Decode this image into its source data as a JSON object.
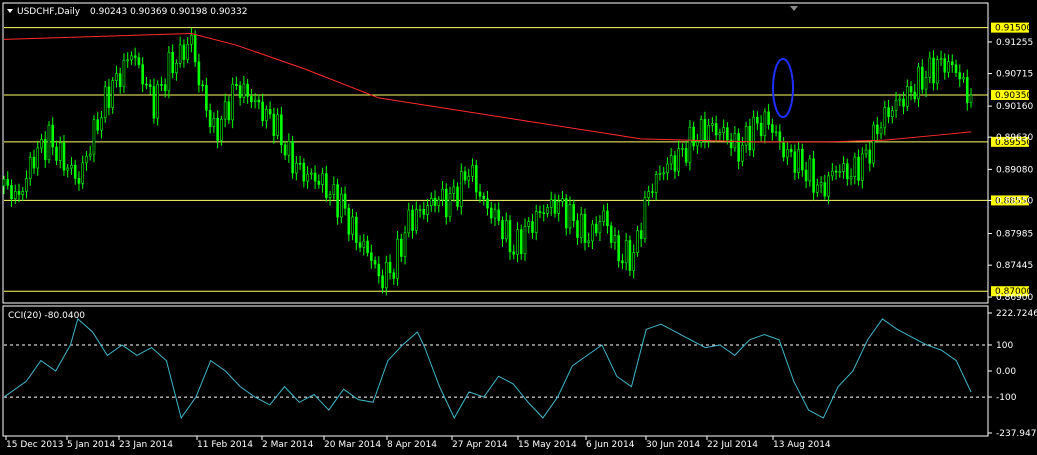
{
  "window": {
    "symbol_title": "USDCHF,Daily",
    "ohlc": "0.90243 0.90369 0.90198 0.90332",
    "menu_arrow": "triangle-down-icon"
  },
  "colors": {
    "background": "#000000",
    "candle_up": "#00ff00",
    "candle_down": "#00ff00",
    "moving_average": "#ff2a2a",
    "horizontal_level": "#ffff66",
    "level_box": "#ffff00",
    "cci_line": "#3fb6c8",
    "annotation_ellipse": "#1f2fff",
    "grid_frame": "#ffffff"
  },
  "chart_data": [
    {
      "type": "candlestick",
      "title": "USDCHF,Daily",
      "ylim": [
        0.8685,
        0.9163
      ],
      "y_ticks": [
        "0.91255",
        "0.90715",
        "0.90160",
        "0.89630",
        "0.89080",
        "0.88550",
        "0.87985",
        "0.87445",
        "0.86900"
      ],
      "x_tick_labels": [
        "15 Dec 2013",
        "5 Jan 2014",
        "23 Jan 2014",
        "11 Feb 2014",
        "2 Mar 2014",
        "20 Mar 2014",
        "8 Apr 2014",
        "27 Apr 2014",
        "15 May 2014",
        "6 Jun 2014",
        "30 Jun 2014",
        "22 Jul 2014",
        "13 Aug 2014"
      ],
      "horizontal_levels": [
        "0.91500",
        "0.90350",
        "0.89550",
        "0.88550",
        "0.87000"
      ],
      "close_path": [
        [
          0,
          0.888
        ],
        [
          4,
          0.886
        ],
        [
          8,
          0.893
        ],
        [
          12,
          0.896
        ],
        [
          16,
          0.892
        ],
        [
          20,
          0.889
        ],
        [
          24,
          0.897
        ],
        [
          28,
          0.904
        ],
        [
          32,
          0.908
        ],
        [
          34,
          0.911
        ],
        [
          38,
          0.905
        ],
        [
          40,
          0.902
        ],
        [
          44,
          0.908
        ],
        [
          48,
          0.911
        ],
        [
          50,
          0.913
        ],
        [
          52,
          0.906
        ],
        [
          56,
          0.897
        ],
        [
          58,
          0.899
        ],
        [
          62,
          0.905
        ],
        [
          66,
          0.903
        ],
        [
          70,
          0.9
        ],
        [
          72,
          0.899
        ],
        [
          76,
          0.893
        ],
        [
          80,
          0.89
        ],
        [
          84,
          0.889
        ],
        [
          88,
          0.886
        ],
        [
          90,
          0.885
        ],
        [
          94,
          0.879
        ],
        [
          98,
          0.876
        ],
        [
          100,
          0.872
        ],
        [
          104,
          0.874
        ],
        [
          108,
          0.882
        ],
        [
          112,
          0.884
        ],
        [
          116,
          0.886
        ],
        [
          118,
          0.885
        ],
        [
          122,
          0.888
        ],
        [
          124,
          0.891
        ],
        [
          128,
          0.885
        ],
        [
          132,
          0.882
        ],
        [
          136,
          0.877
        ],
        [
          140,
          0.881
        ],
        [
          144,
          0.884
        ],
        [
          148,
          0.885
        ],
        [
          152,
          0.882
        ],
        [
          156,
          0.879
        ],
        [
          160,
          0.883
        ],
        [
          164,
          0.876
        ],
        [
          168,
          0.876
        ],
        [
          172,
          0.887
        ],
        [
          176,
          0.891
        ],
        [
          180,
          0.893
        ],
        [
          184,
          0.896
        ],
        [
          188,
          0.898
        ],
        [
          192,
          0.897
        ],
        [
          196,
          0.894
        ],
        [
          200,
          0.898
        ],
        [
          204,
          0.899
        ],
        [
          208,
          0.894
        ],
        [
          212,
          0.892
        ],
        [
          216,
          0.889
        ],
        [
          218,
          0.887
        ],
        [
          222,
          0.891
        ],
        [
          226,
          0.89
        ],
        [
          230,
          0.893
        ],
        [
          234,
          0.899
        ],
        [
          238,
          0.902
        ],
        [
          242,
          0.904
        ],
        [
          246,
          0.907
        ],
        [
          250,
          0.909
        ],
        [
          254,
          0.908
        ],
        [
          256,
          0.905
        ],
        [
          258,
          0.903
        ]
      ],
      "moving_average": [
        [
          0,
          0.913
        ],
        [
          50,
          0.914
        ],
        [
          62,
          0.912
        ],
        [
          80,
          0.908
        ],
        [
          100,
          0.903
        ],
        [
          120,
          0.901
        ],
        [
          140,
          0.899
        ],
        [
          160,
          0.897
        ],
        [
          170,
          0.896
        ],
        [
          200,
          0.8955
        ],
        [
          220,
          0.8955
        ],
        [
          235,
          0.8958
        ],
        [
          250,
          0.8967
        ],
        [
          258,
          0.8972
        ]
      ]
    },
    {
      "type": "line",
      "title": "CCI(20) -80.0400",
      "ylim": [
        -237.9474,
        222.7246
      ],
      "y_ticks": [
        "222.7246",
        "100",
        "0.00",
        "-100",
        "-237.9474"
      ],
      "dashed_levels": [
        100,
        -100
      ],
      "values": [
        [
          0,
          -100
        ],
        [
          6,
          -40
        ],
        [
          10,
          40
        ],
        [
          14,
          0
        ],
        [
          18,
          100
        ],
        [
          20,
          200
        ],
        [
          24,
          150
        ],
        [
          28,
          60
        ],
        [
          32,
          100
        ],
        [
          36,
          60
        ],
        [
          40,
          90
        ],
        [
          44,
          40
        ],
        [
          48,
          -180
        ],
        [
          52,
          -100
        ],
        [
          56,
          40
        ],
        [
          60,
          0
        ],
        [
          64,
          -60
        ],
        [
          68,
          -100
        ],
        [
          72,
          -130
        ],
        [
          76,
          -60
        ],
        [
          80,
          -120
        ],
        [
          84,
          -90
        ],
        [
          88,
          -150
        ],
        [
          92,
          -70
        ],
        [
          96,
          -110
        ],
        [
          100,
          -120
        ],
        [
          104,
          40
        ],
        [
          108,
          100
        ],
        [
          112,
          150
        ],
        [
          114,
          90
        ],
        [
          118,
          -60
        ],
        [
          122,
          -180
        ],
        [
          126,
          -80
        ],
        [
          130,
          -100
        ],
        [
          134,
          -20
        ],
        [
          138,
          -50
        ],
        [
          142,
          -120
        ],
        [
          146,
          -180
        ],
        [
          150,
          -100
        ],
        [
          154,
          20
        ],
        [
          158,
          60
        ],
        [
          162,
          100
        ],
        [
          166,
          -20
        ],
        [
          170,
          -60
        ],
        [
          174,
          160
        ],
        [
          178,
          180
        ],
        [
          182,
          150
        ],
        [
          186,
          120
        ],
        [
          190,
          90
        ],
        [
          194,
          100
        ],
        [
          198,
          60
        ],
        [
          202,
          120
        ],
        [
          206,
          140
        ],
        [
          210,
          120
        ],
        [
          214,
          -40
        ],
        [
          218,
          -150
        ],
        [
          222,
          -180
        ],
        [
          226,
          -60
        ],
        [
          230,
          0
        ],
        [
          234,
          120
        ],
        [
          238,
          200
        ],
        [
          242,
          160
        ],
        [
          246,
          130
        ],
        [
          250,
          100
        ],
        [
          254,
          80
        ],
        [
          258,
          40
        ],
        [
          262,
          -80
        ]
      ]
    }
  ]
}
